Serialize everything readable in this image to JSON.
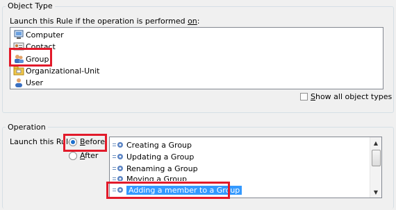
{
  "object_type": {
    "title": "Object Type",
    "prompt": "Launch this Rule if the operation is performed ",
    "prompt_key": "on",
    "prompt_end": ":",
    "items": [
      {
        "label": "Computer",
        "icon": "computer-icon"
      },
      {
        "label": "Contact",
        "icon": "contact-icon"
      },
      {
        "label": "Group",
        "icon": "group-icon"
      },
      {
        "label": "Organizational-Unit",
        "icon": "organizational-unit-icon"
      },
      {
        "label": "User",
        "icon": "user-icon"
      }
    ],
    "show_all": {
      "key": "S",
      "rest": "how all object types",
      "checked": false
    }
  },
  "operation": {
    "title": "Operation",
    "prompt": "Launch this Rule",
    "before": {
      "key": "B",
      "rest": "efore",
      "selected": true
    },
    "after": {
      "key": "A",
      "rest": "fter",
      "selected": false
    },
    "items": [
      "Creating a Group",
      "Updating a Group",
      "Renaming a Group",
      "Moving a Group",
      "Adding a member to a Group"
    ],
    "selected_index": 4
  },
  "colors": {
    "highlight": "#e21a2a",
    "selection": "#3399ff"
  }
}
